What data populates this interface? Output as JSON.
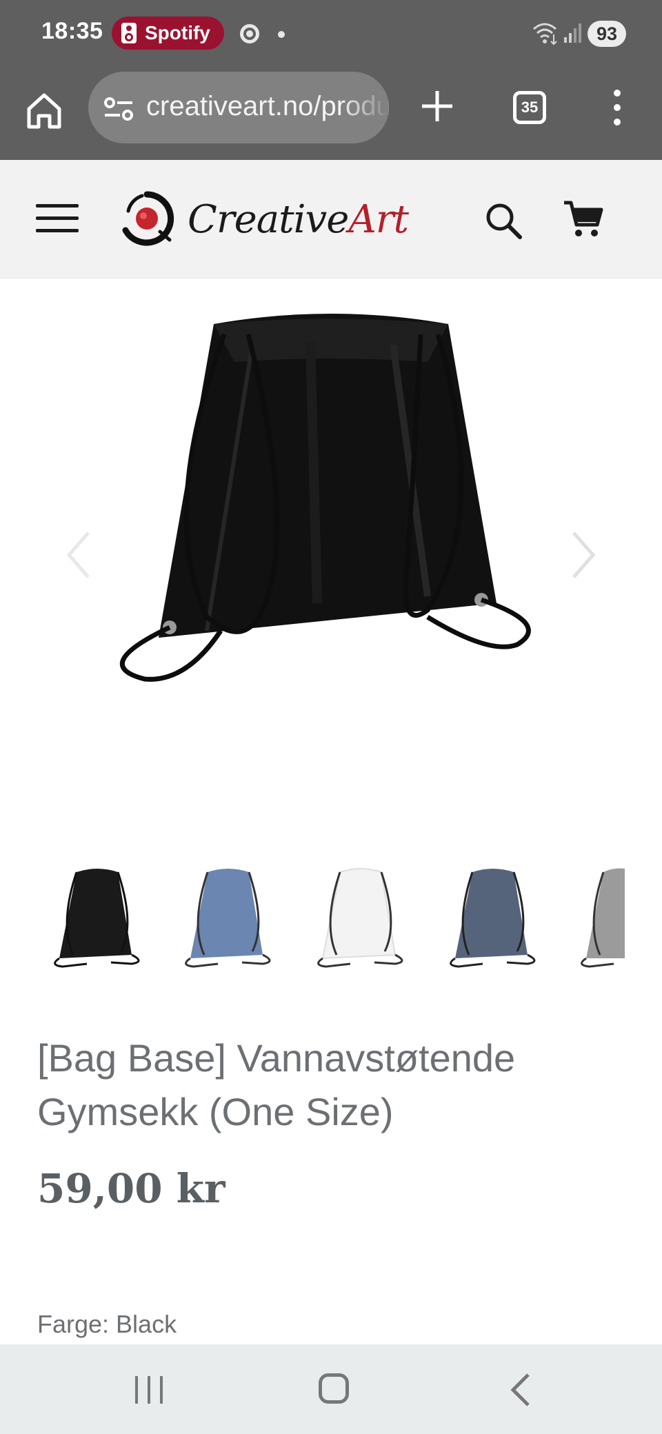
{
  "status_bar": {
    "time": "18:35",
    "media_app": "Spotify",
    "battery": "93",
    "icons": [
      "speaker-icon",
      "chrome-icon",
      "dot-icon",
      "wifi-icon",
      "signal-icon"
    ]
  },
  "browser": {
    "url": "creativeart.no/products/bag-base-vannavstotende-gymsekk",
    "tab_count": "35",
    "icons": [
      "home-icon",
      "site-settings-icon",
      "plus-icon",
      "menu-dots-icon"
    ]
  },
  "site": {
    "brand_part1": "Creative",
    "brand_part2": "Art",
    "icons": [
      "hamburger-icon",
      "logo-mark",
      "search-icon",
      "cart-icon"
    ]
  },
  "product": {
    "title": "[Bag Base] Vannavstøtende Gymsekk (One Size)",
    "price": "59,00 kr",
    "color_label": "Farge: Black",
    "thumbnail_colors": [
      "#1a1a1a",
      "#6b86b0",
      "#f3f3f3",
      "#56647b",
      "#9b9b9b"
    ]
  },
  "nav": {
    "icons": [
      "recents-icon",
      "home-icon",
      "back-icon"
    ]
  }
}
